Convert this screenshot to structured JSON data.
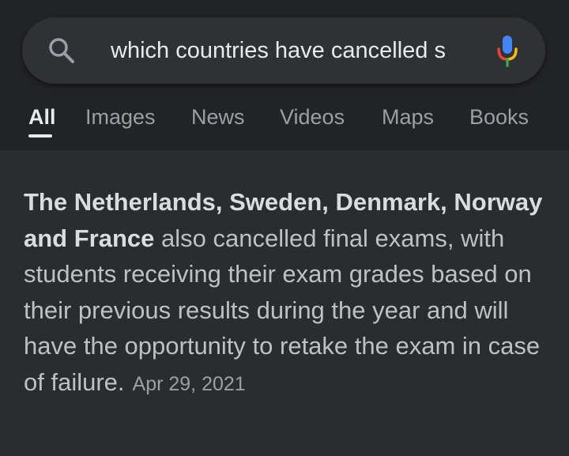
{
  "search": {
    "query": "which countries have cancelled s",
    "search_icon": "search-icon",
    "mic_icon": "mic-icon"
  },
  "tabs": [
    {
      "label": "All",
      "active": true
    },
    {
      "label": "Images",
      "active": false
    },
    {
      "label": "News",
      "active": false
    },
    {
      "label": "Videos",
      "active": false
    },
    {
      "label": "Maps",
      "active": false
    },
    {
      "label": "Books",
      "active": false
    }
  ],
  "snippet": {
    "highlight": "The Netherlands, Sweden, Denmark, Norway and France",
    "text": " also cancelled final exams, with students receiving their exam grades based on their previous results during the year and will have the opportunity to retake the exam in case of failure.",
    "date": "Apr 29, 2021"
  },
  "colors": {
    "background": "#2b2c2f",
    "header_background": "#222326",
    "search_bar": "#303134",
    "text_primary": "#e8eaed",
    "text_secondary": "#9aa0a6",
    "snippet_text": "#bdc1c6",
    "mic_blue": "#4285f4",
    "mic_red": "#ea4335",
    "mic_yellow": "#fbbc05",
    "mic_green": "#34a853"
  }
}
